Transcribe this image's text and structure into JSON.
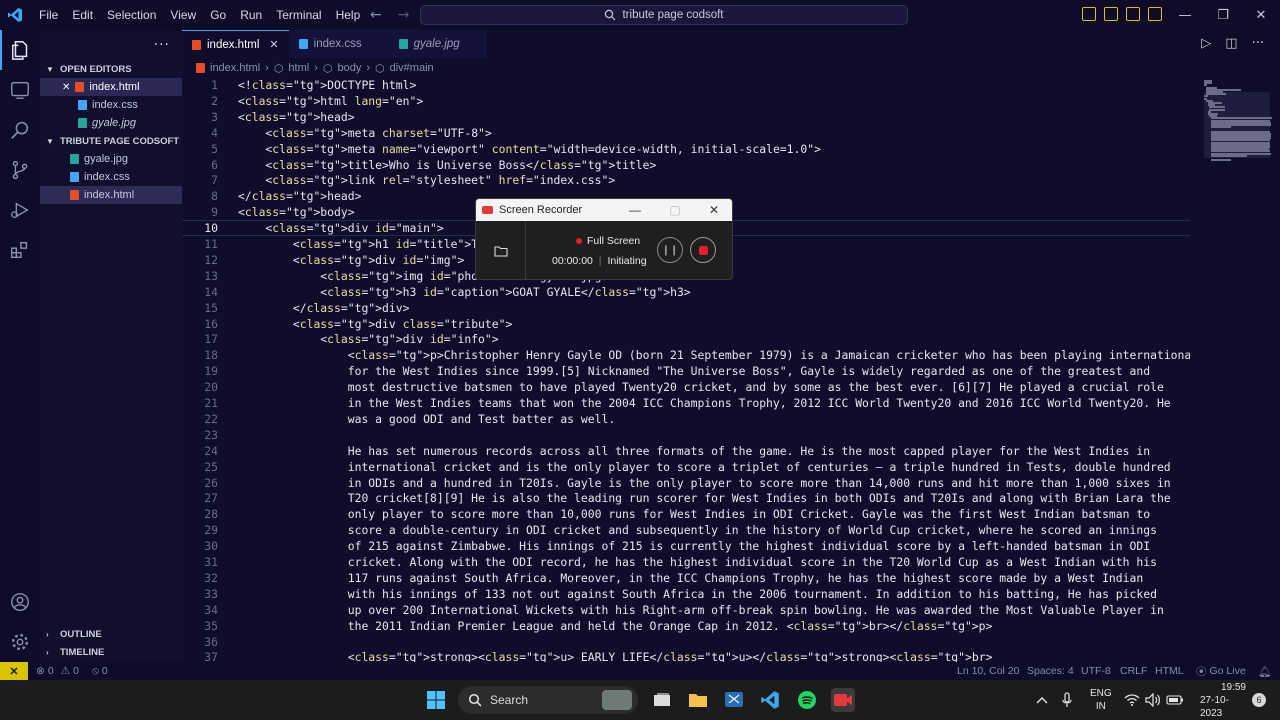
{
  "menu": [
    "File",
    "Edit",
    "Selection",
    "View",
    "Go",
    "Run",
    "Terminal",
    "Help"
  ],
  "command_center": "tribute page codsoft",
  "sidebar": {
    "more": "···",
    "open_editors_title": "OPEN EDITORS",
    "open_editors": [
      {
        "name": "index.html",
        "type": "html",
        "close": "✕"
      },
      {
        "name": "index.css",
        "type": "css"
      },
      {
        "name": "gyale.jpg",
        "type": "img"
      }
    ],
    "project_title": "TRIBUTE PAGE CODSOFT",
    "project_files": [
      {
        "name": "gyale.jpg",
        "type": "img"
      },
      {
        "name": "index.css",
        "type": "css"
      },
      {
        "name": "index.html",
        "type": "html"
      }
    ],
    "outline": "OUTLINE",
    "timeline": "TIMELINE"
  },
  "tabs": [
    {
      "label": "index.html",
      "type": "html",
      "close": "✕"
    },
    {
      "label": "index.css",
      "type": "css"
    },
    {
      "label": "gyale.jpg",
      "type": "img"
    }
  ],
  "breadcrumb": [
    "index.html",
    "html",
    "body",
    "div#main"
  ],
  "editor": {
    "lines": [
      {
        "n": "1",
        "code": "<!DOCTYPE html>"
      },
      {
        "n": "2",
        "code": "<html lang=\"en\">"
      },
      {
        "n": "3",
        "code": "<head>"
      },
      {
        "n": "4",
        "code": "    <meta charset=\"UTF-8\">"
      },
      {
        "n": "5",
        "code": "    <meta name=\"viewport\" content=\"width=device-width, initial-scale=1.0\">"
      },
      {
        "n": "6",
        "code": "    <title>Who is Universe Boss</title>"
      },
      {
        "n": "7",
        "code": "    <link rel=\"stylesheet\" href=\"index.css\">"
      },
      {
        "n": "8",
        "code": "</head>"
      },
      {
        "n": "9",
        "code": "<body>"
      },
      {
        "n": "10",
        "code": "    <div id=\"main\">"
      },
      {
        "n": "11",
        "code": "        <h1 id=\"title\">The Universe B"
      },
      {
        "n": "12",
        "code": "        <div id=\"img\">"
      },
      {
        "n": "13",
        "code": "            <img id=\"photo\" src=\"gyale.jpg\""
      },
      {
        "n": "14",
        "code": "            <h3 id=\"caption\">GOAT GYALE</h3>"
      },
      {
        "n": "15",
        "code": "        </div>"
      },
      {
        "n": "16",
        "code": "        <div class=\"tribute\">"
      },
      {
        "n": "17",
        "code": "            <div id=\"info\">"
      },
      {
        "n": "18",
        "code": "                <p>Christopher Henry Gayle OD (born 21 September 1979) is a Jamaican cricketer who has been playing international cricket"
      },
      {
        "n": "19",
        "code": "                for the West Indies since 1999.[5] Nicknamed \"The Universe Boss\", Gayle is widely regarded as one of the greatest and"
      },
      {
        "n": "20",
        "code": "                most destructive batsmen to have played Twenty20 cricket, and by some as the best ever. [6][7] He played a crucial role"
      },
      {
        "n": "21",
        "code": "                in the West Indies teams that won the 2004 ICC Champions Trophy, 2012 ICC World Twenty20 and 2016 ICC World Twenty20. He"
      },
      {
        "n": "22",
        "code": "                was a good ODI and Test batter as well."
      },
      {
        "n": "23",
        "code": ""
      },
      {
        "n": "24",
        "code": "                He has set numerous records across all three formats of the game. He is the most capped player for the West Indies in"
      },
      {
        "n": "25",
        "code": "                international cricket and is the only player to score a triplet of centuries – a triple hundred in Tests, double hundred"
      },
      {
        "n": "26",
        "code": "                in ODIs and a hundred in T20Is. Gayle is the only player to score more than 14,000 runs and hit more than 1,000 sixes in"
      },
      {
        "n": "27",
        "code": "                T20 cricket[8][9] He is also the leading run scorer for West Indies in both ODIs and T20Is and along with Brian Lara the"
      },
      {
        "n": "28",
        "code": "                only player to score more than 10,000 runs for West Indies in ODI Cricket. Gayle was the first West Indian batsman to"
      },
      {
        "n": "29",
        "code": "                score a double-century in ODI cricket and subsequently in the history of World Cup cricket, where he scored an innings"
      },
      {
        "n": "30",
        "code": "                of 215 against Zimbabwe. His innings of 215 is currently the highest individual score by a left-handed batsman in ODI"
      },
      {
        "n": "31",
        "code": "                cricket. Along with the ODI record, he has the highest individual score in the T20 World Cup as a West Indian with his"
      },
      {
        "n": "32",
        "code": "                117 runs against South Africa. Moreover, in the ICC Champions Trophy, he has the highest score made by a West Indian"
      },
      {
        "n": "33",
        "code": "                with his innings of 133 not out against South Africa in the 2006 tournament. In addition to his batting, He has picked"
      },
      {
        "n": "34",
        "code": "                up over 200 International Wickets with his Right-arm off-break spin bowling. He was awarded the Most Valuable Player in"
      },
      {
        "n": "35",
        "code": "                the 2011 Indian Premier League and held the Orange Cap in 2012. <br></p>"
      },
      {
        "n": "36",
        "code": ""
      },
      {
        "n": "37",
        "code": "                <strong><u> EARLY LIFE</u></strong><br>"
      }
    ]
  },
  "recorder": {
    "title": "Screen Recorder",
    "minimize": "—",
    "maximize": "▢",
    "close": "✕",
    "mode": "Full Screen",
    "time": "00:00:00",
    "status": "Initiating",
    "pause": "❙❙"
  },
  "statusbar": {
    "remote": "✕",
    "errors": "0",
    "warnings": "0",
    "ports": "0",
    "position": "Ln 10, Col 20",
    "spaces": "Spaces: 4",
    "encoding": "UTF-8",
    "eol": "CRLF",
    "language": "HTML",
    "golive": "Go Live"
  },
  "taskbar": {
    "search": "Search",
    "lang_top": "ENG",
    "lang_bottom": "IN",
    "time": "19:59",
    "date": "27-10-2023",
    "notifications": "6"
  },
  "colors": {
    "background": "#100d2c",
    "tag": "#e5533d",
    "accent": "#3da6f5",
    "remote": "#d9c400"
  }
}
